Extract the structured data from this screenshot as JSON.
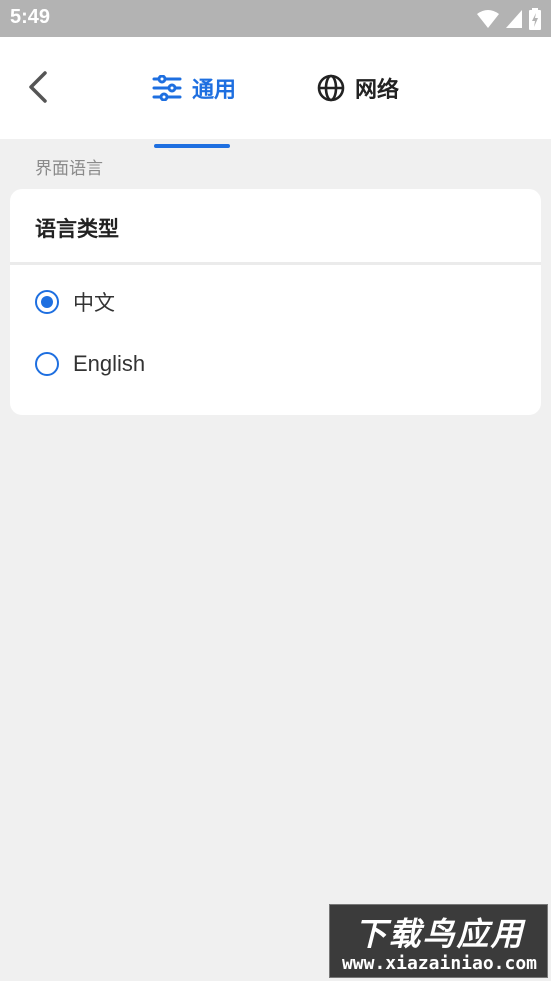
{
  "status_bar": {
    "time": "5:49",
    "icons": [
      "wifi-icon",
      "signal-icon",
      "battery-charging-icon"
    ]
  },
  "header": {
    "back_icon": "chevron-left-icon",
    "tabs": [
      {
        "label": "通用",
        "icon": "sliders-icon",
        "active": true
      },
      {
        "label": "网络",
        "icon": "globe-icon",
        "active": false
      }
    ]
  },
  "section": {
    "label": "界面语言",
    "card_title": "语言类型",
    "options": [
      {
        "label": "中文",
        "selected": true
      },
      {
        "label": "English",
        "selected": false
      }
    ]
  },
  "watermark": {
    "title": "下载鸟应用",
    "url": "www.xiazainiao.com"
  },
  "colors": {
    "accent": "#1e6fe0",
    "background": "#f0f0f0",
    "status_bar": "#b3b3b3"
  }
}
